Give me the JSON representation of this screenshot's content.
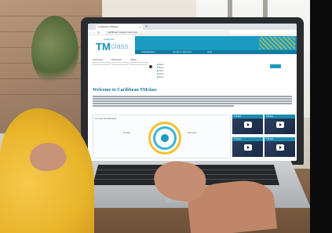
{
  "browser": {
    "tab_title": "Caribbean TMclass",
    "url": "caribbean.tmclass.tmdn.org/..."
  },
  "site": {
    "logo_small": "Caribbean",
    "logo_tm": "TM",
    "logo_class": "class",
    "nav_links": [
      "Classification",
      "Goods & Services",
      "Help"
    ],
    "login_labels": [
      "Username",
      "Password",
      "Office"
    ],
    "list_items": [
      "Item",
      "Item",
      "Item",
      "Item",
      "Item"
    ],
    "welcome_title": "Welcome to Caribbean TMclass",
    "section_title": "Consult classification",
    "chart_labels": [
      "Goods",
      "Services"
    ],
    "videos": [
      "TMclass",
      "TMclass",
      "TMclass",
      "TMclass"
    ]
  },
  "colors": {
    "brand_teal": "#1a9bc1",
    "accent_yellow": "#f2c230"
  }
}
